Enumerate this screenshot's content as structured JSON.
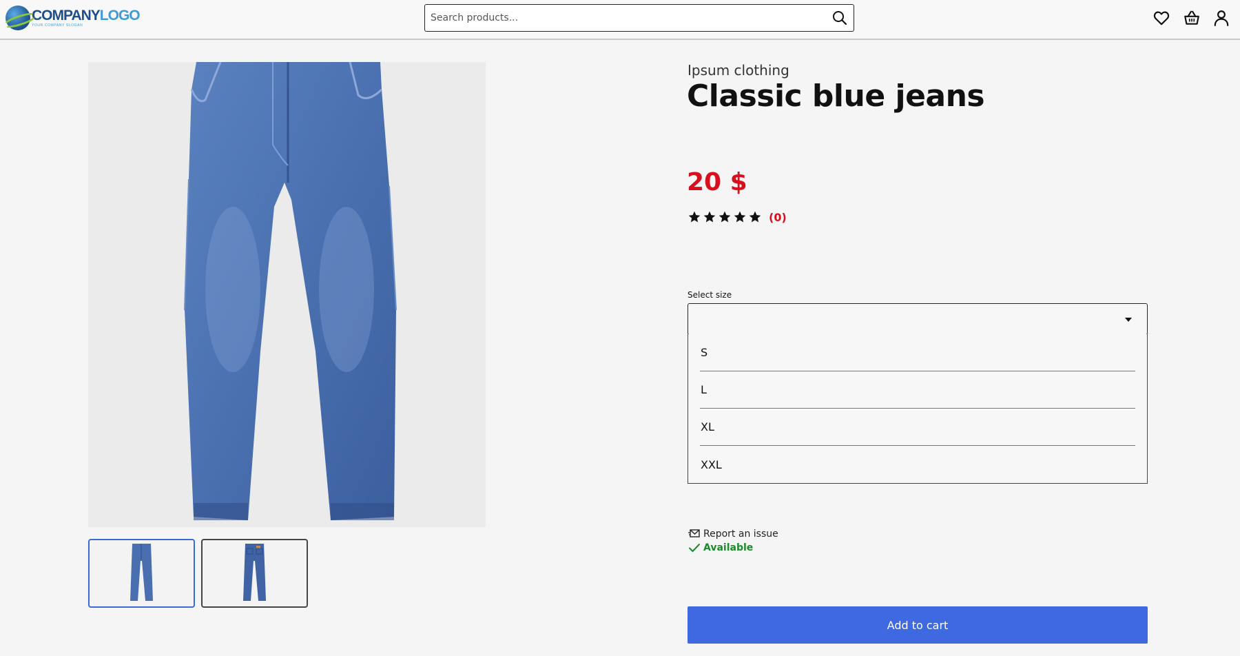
{
  "header": {
    "logo": {
      "main_a": "COMPANY",
      "main_b": "LOGO",
      "slogan": "YOUR COMPANY SLOGAN"
    },
    "search": {
      "placeholder": "Search products..."
    },
    "icons": [
      "heart-icon",
      "basket-icon",
      "user-icon"
    ]
  },
  "gallery": {
    "thumbnails": [
      {
        "view": "front",
        "active": true
      },
      {
        "view": "back",
        "active": false
      }
    ]
  },
  "product": {
    "brand": "Ipsum clothing",
    "title": "Classic blue jeans",
    "price": "20 $",
    "rating": {
      "stars": 5,
      "count": "(0)"
    }
  },
  "size": {
    "label": "Select size",
    "selected": "",
    "options": [
      "S",
      "L",
      "XL",
      "XXL"
    ]
  },
  "actions": {
    "report": "Report an issue",
    "availability": "Available",
    "add_to_cart": "Add to cart"
  },
  "colors": {
    "price": "#d8101e",
    "cart_button": "#3f69e0",
    "available": "#1a8a2a",
    "thumb_active_border": "#3a6ad6"
  }
}
